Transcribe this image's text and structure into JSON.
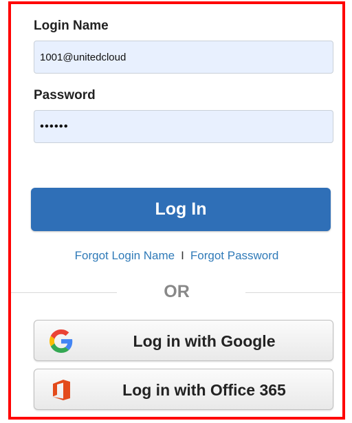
{
  "form": {
    "login_name": {
      "label": "Login Name",
      "value": "1001@unitedcloud"
    },
    "password": {
      "label": "Password",
      "value": "••••••"
    }
  },
  "login_button": {
    "label": "Log In",
    "color": "#2f6fb7"
  },
  "links": {
    "forgot_login_name": "Forgot Login Name",
    "separator": "I",
    "forgot_password": "Forgot Password",
    "color": "#2f7ab8"
  },
  "divider": {
    "text": "OR"
  },
  "sso": {
    "google": {
      "label": "Log in with Google",
      "icon": "google-g-icon"
    },
    "office365": {
      "label": "Log in with Office 365",
      "icon": "office-365-icon"
    }
  },
  "frame": {
    "border_color": "#ff0000"
  }
}
